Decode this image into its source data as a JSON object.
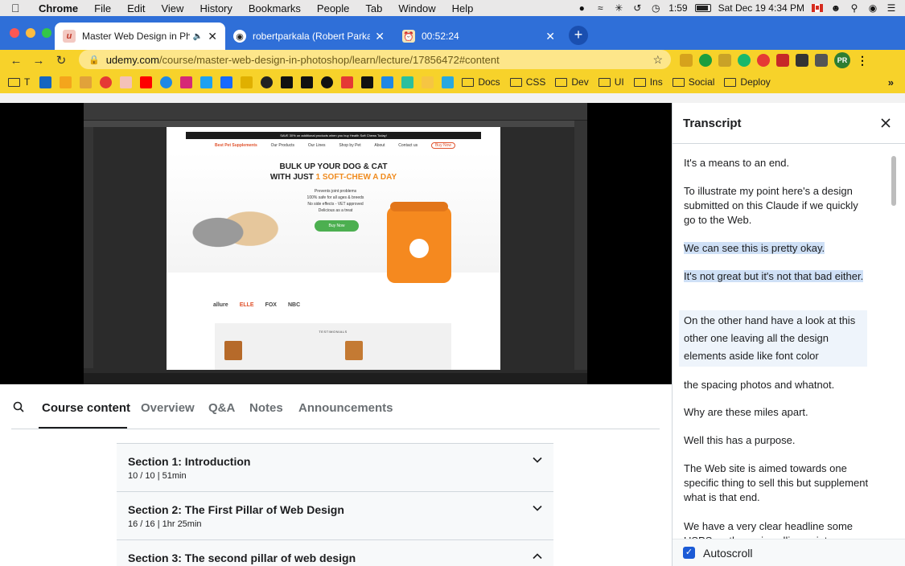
{
  "menubar": {
    "app": "Chrome",
    "items": [
      "File",
      "Edit",
      "View",
      "History",
      "Bookmarks",
      "People",
      "Tab",
      "Window",
      "Help"
    ],
    "time": "1:59",
    "datetime": "Sat Dec 19  4:34 PM"
  },
  "tabs": [
    {
      "title": "Master Web Design in Phot",
      "active": true
    },
    {
      "title": "robertparkala (Robert Parkala)",
      "active": false
    },
    {
      "title": "00:52:24",
      "active": false
    }
  ],
  "address": {
    "host": "udemy.com",
    "path": "/course/master-web-design-in-photoshop/learn/lecture/17856472#content"
  },
  "bookmarks": {
    "first_label": "T",
    "folders": [
      "Docs",
      "CSS",
      "Dev",
      "UI",
      "Ins",
      "Social",
      "Deploy"
    ]
  },
  "canvas": {
    "promo": "SAVE 30% on additional products when you buy Health Soft Chews Today!",
    "logo": "Best Pet Supplements",
    "nav": [
      "Our Products",
      "Our Lines",
      "Shop by Pet",
      "About",
      "Contact us"
    ],
    "cta_nav": "Buy Now",
    "headline1": "BULK UP YOUR DOG & CAT",
    "headline2": "WITH JUST",
    "headline_accent": "1 SOFT-CHEW A DAY",
    "sub": [
      "Prevents joint problems",
      "100% safe for all ages & breeds",
      "No side effects - VET approved",
      "Delicious as a treat"
    ],
    "buy": "Buy Now",
    "logos": [
      "allure",
      "ELLE",
      "FOX",
      "NBC"
    ],
    "testimonials": "TESTIMONIALS"
  },
  "course_tabs": {
    "items": [
      "Course content",
      "Overview",
      "Q&A",
      "Notes",
      "Announcements"
    ],
    "active": "Course content"
  },
  "sections": [
    {
      "title": "Section 1: Introduction",
      "meta": "10 / 10 | 51min",
      "expanded": false
    },
    {
      "title": "Section 2: The First Pillar of Web Design",
      "meta": "16 / 16 | 1hr 25min",
      "expanded": false
    },
    {
      "title": "Section 3: The second pillar of web design",
      "meta": "",
      "expanded": true
    }
  ],
  "transcript": {
    "title": "Transcript",
    "cues": [
      "It's a means to an end.",
      "To illustrate my point here's a design submitted on this Claude if we quickly go to the Web.",
      "We can see this is pretty okay.",
      "It's not great but it's not that bad either.",
      "On the other hand have a look at this other one leaving all the design elements aside like font color",
      "the spacing photos and whatnot.",
      "Why are these miles apart.",
      "Well this has a purpose.",
      "The Web site is aimed towards one specific thing to sell this but supplement what is that end.",
      "We have a very clear headline some USPS as the main selling point"
    ],
    "autoscroll_label": "Autoscroll",
    "autoscroll": true
  },
  "colors": {
    "tabbar": "#2f6fd8",
    "toolbar": "#f7d22a",
    "highlight": "#cfe0f6",
    "udemy_dark": "#1c1d1f"
  }
}
